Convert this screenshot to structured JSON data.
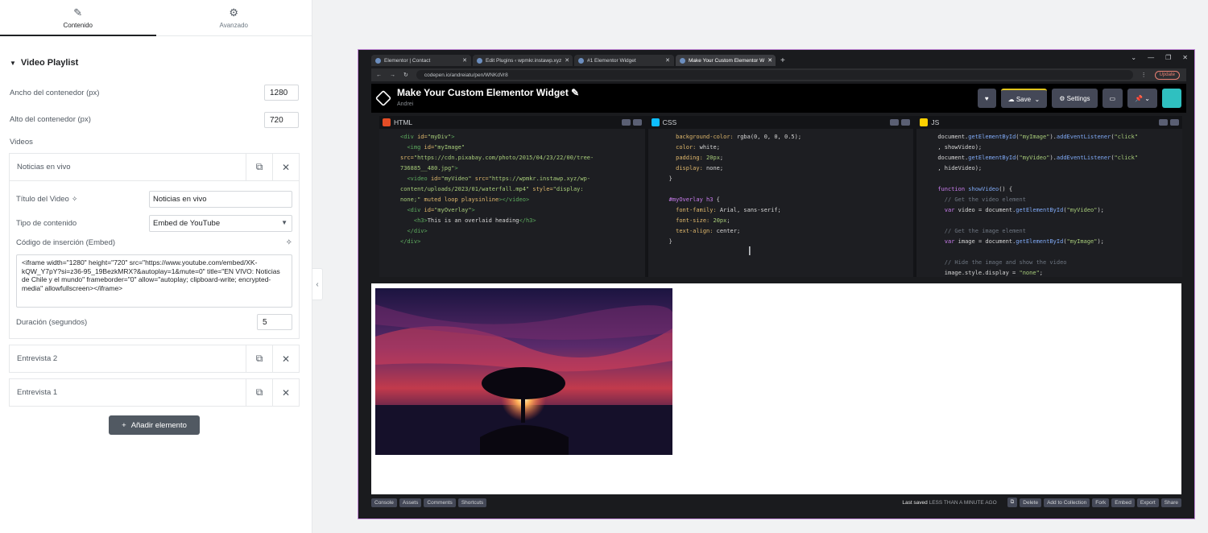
{
  "panel": {
    "tabs": [
      {
        "label": "Contenido",
        "icon": "pencil-icon"
      },
      {
        "label": "Avanzado",
        "icon": "gear-icon"
      }
    ],
    "section_title": "Video Playlist",
    "container_width_label": "Ancho del contenedor (px)",
    "container_width_value": "1280",
    "container_height_label": "Alto del contenedor (px)",
    "container_height_value": "720",
    "videos_label": "Videos",
    "items": [
      {
        "title": "Noticias en vivo",
        "expanded": true
      },
      {
        "title": "Entrevista 2",
        "expanded": false
      },
      {
        "title": "Entrevista 1",
        "expanded": false
      }
    ],
    "item_fields": {
      "video_title_label": "Título del Video",
      "video_title_value": "Noticias en vivo",
      "content_type_label": "Tipo de contenido",
      "content_type_value": "Embed de YouTube",
      "embed_code_label": "Código de inserción (Embed)",
      "embed_code_value": "<iframe width=\"1280\" height=\"720\" src=\"https://www.youtube.com/embed/XK-kQW_Y7pY?si=z36-95_19BezkMRX?&autoplay=1&mute=0\" title=\"EN VIVO: Noticias de Chile y el mundo\" frameborder=\"0\" allow=\"autoplay; clipboard-write; encrypted-media\" allowfullscreen></iframe>",
      "duration_label": "Duración (segundos)",
      "duration_value": "5"
    },
    "add_button_label": "Añadir elemento"
  },
  "preview": {
    "browser_tabs": [
      {
        "label": "Elementor | Contact",
        "active": false
      },
      {
        "label": "Edit Plugins ‹ wpmkr.instawp.xyz",
        "active": false
      },
      {
        "label": "#1 Elementor Widget",
        "active": false
      },
      {
        "label": "Make Your Custom Elementor W",
        "active": true
      }
    ],
    "address": "codepen.io/andreiatu/pen/WNKdVr8",
    "update_label": "Update",
    "pen_title": "Make Your Custom Elementor Widget",
    "pen_author": "Andrei",
    "buttons": {
      "save": "Save",
      "settings": "Settings"
    },
    "editors": [
      {
        "name": "HTML",
        "color": "#e44d26"
      },
      {
        "name": "CSS",
        "color": "#0ebeff"
      },
      {
        "name": "JS",
        "color": "#fcd000"
      }
    ],
    "footer_buttons_left": [
      "Console",
      "Assets",
      "Comments",
      "Shortcuts"
    ],
    "last_saved_label": "Last saved",
    "last_saved_value": "LESS THAN A MINUTE AGO",
    "footer_buttons_right": [
      "Delete",
      "Add to Collection",
      "Fork",
      "Embed",
      "Export",
      "Share"
    ]
  }
}
